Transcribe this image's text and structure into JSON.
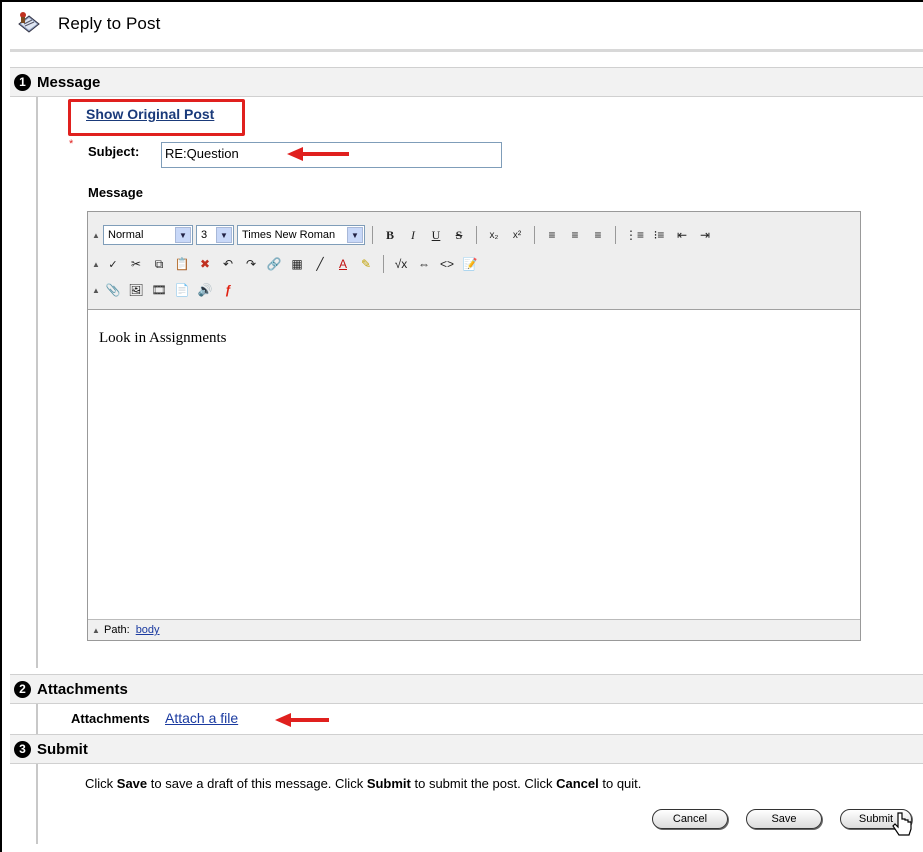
{
  "header": {
    "title": "Reply to Post"
  },
  "sections": [
    {
      "number": "1",
      "title": "Message"
    },
    {
      "number": "2",
      "title": "Attachments"
    },
    {
      "number": "3",
      "title": "Submit"
    }
  ],
  "message": {
    "show_original": "Show Original Post",
    "required_mark": "*",
    "subject_label": "Subject:",
    "subject_value": "RE:Question",
    "message_label": "Message",
    "toolbar": {
      "format_select": "Normal",
      "size_select": "3",
      "font_select": "Times New Roman"
    },
    "body_text": "Look in Assignments",
    "path_label": "Path:",
    "path_value": "body"
  },
  "attachments": {
    "label": "Attachments",
    "link": "Attach a file"
  },
  "submit": {
    "instr_1": "Click ",
    "save_word": "Save",
    "instr_2": " to save a draft of this message. Click ",
    "submit_word": "Submit",
    "instr_3": " to submit the post. Click ",
    "cancel_word": "Cancel",
    "instr_4": " to quit.",
    "cancel_button": "Cancel",
    "save_button": "Save",
    "submit_button": "Submit"
  },
  "colors": {
    "highlight_red": "#e0201e",
    "link_blue": "#1a3aa0",
    "bar_gray": "#f2f2f2"
  },
  "icons": [
    "discussion-post-icon",
    "red-arrow-icon",
    "hand-cursor-icon"
  ]
}
